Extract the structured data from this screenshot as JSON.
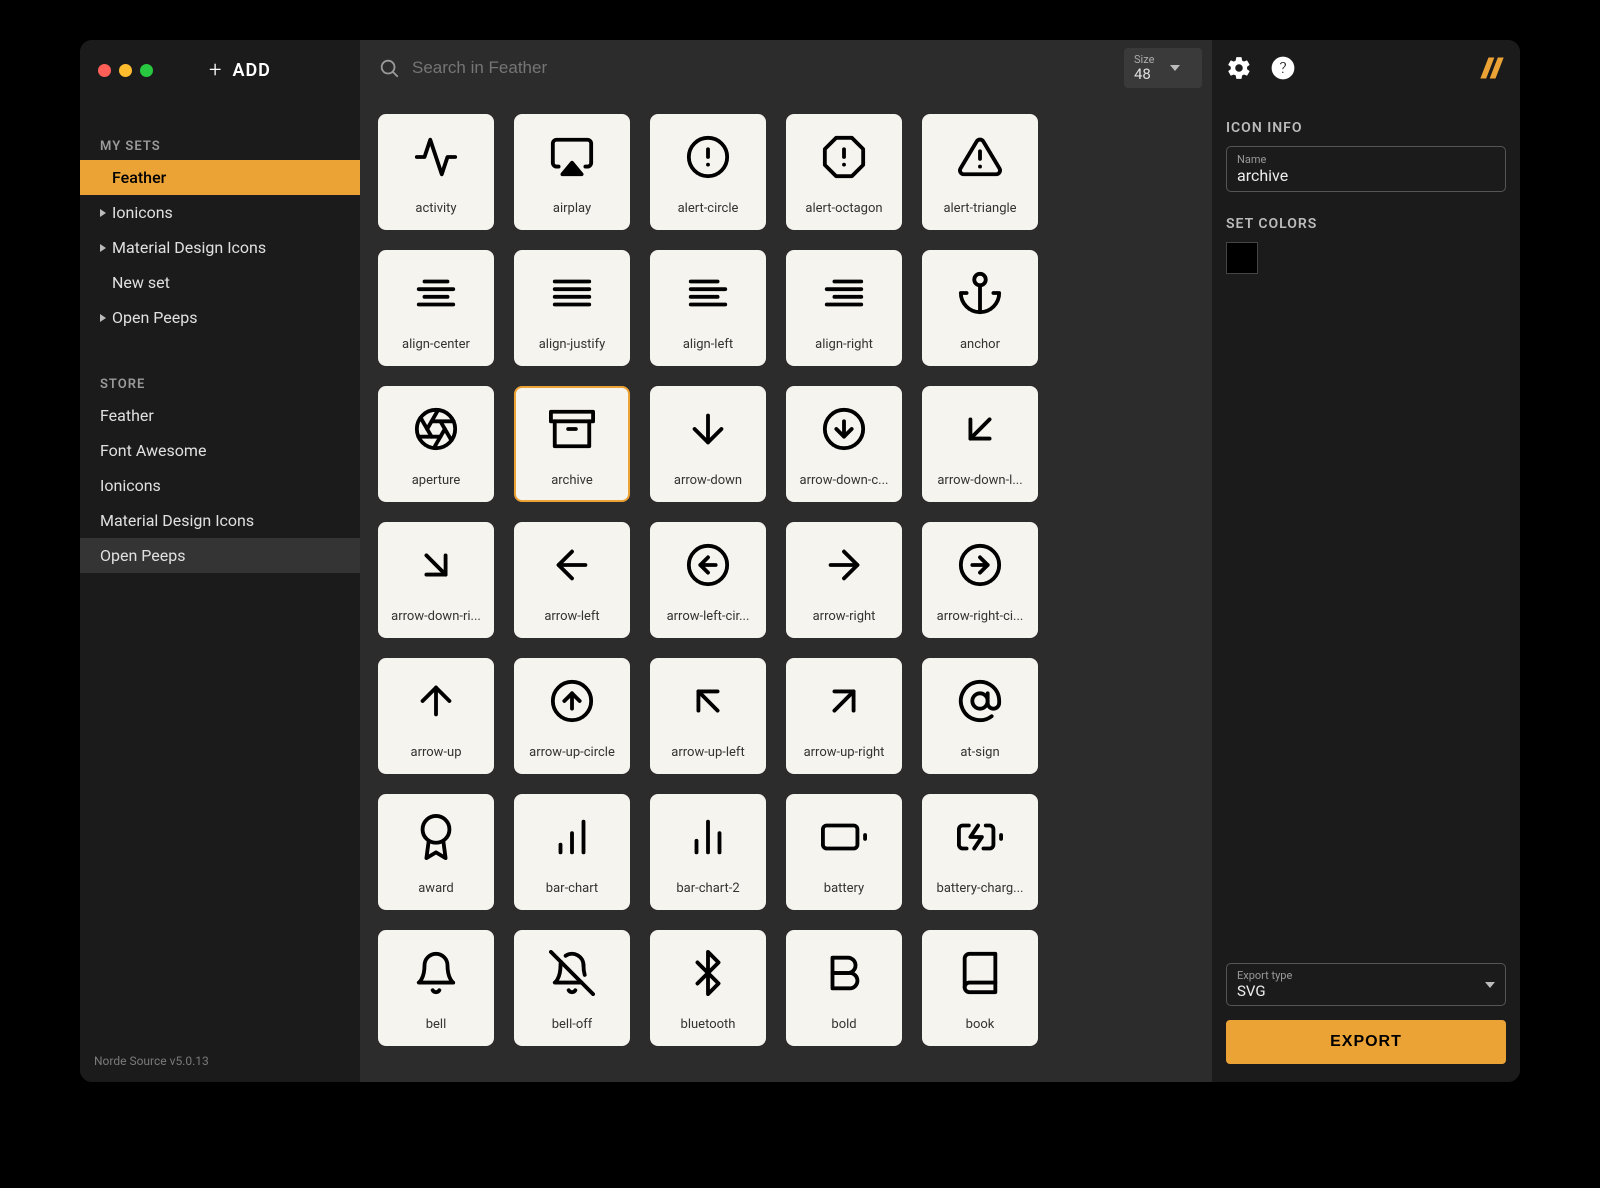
{
  "header": {
    "add_label": "ADD",
    "search_placeholder": "Search in Feather",
    "size_label": "Size",
    "size_value": "48"
  },
  "sidebar": {
    "my_sets_heading": "MY SETS",
    "store_heading": "STORE",
    "my_sets": [
      {
        "label": "Feather",
        "expandable": false,
        "active": true
      },
      {
        "label": "Ionicons",
        "expandable": true
      },
      {
        "label": "Material Design Icons",
        "expandable": true
      },
      {
        "label": "New set",
        "expandable": false
      },
      {
        "label": "Open Peeps",
        "expandable": true
      }
    ],
    "store": [
      {
        "label": "Feather"
      },
      {
        "label": "Font Awesome"
      },
      {
        "label": "Ionicons"
      },
      {
        "label": "Material Design Icons"
      },
      {
        "label": "Open Peeps",
        "hover": true
      }
    ],
    "version": "Norde Source v5.0.13"
  },
  "icons": [
    "activity",
    "airplay",
    "alert-circle",
    "alert-octagon",
    "alert-triangle",
    "align-center",
    "align-justify",
    "align-left",
    "align-right",
    "anchor",
    "aperture",
    "archive",
    "arrow-down",
    "arrow-down-circle",
    "arrow-down-left",
    "arrow-down-right",
    "arrow-left",
    "arrow-left-circle",
    "arrow-right",
    "arrow-right-circle",
    "arrow-up",
    "arrow-up-circle",
    "arrow-up-left",
    "arrow-up-right",
    "at-sign",
    "award",
    "bar-chart",
    "bar-chart-2",
    "battery",
    "battery-charging",
    "bell",
    "bell-off",
    "bluetooth",
    "bold",
    "book"
  ],
  "selected_icon": "archive",
  "icon_display_names": {
    "arrow-down-circle": "arrow-down-c...",
    "arrow-down-left": "arrow-down-l...",
    "arrow-down-right": "arrow-down-ri...",
    "arrow-left-circle": "arrow-left-cir...",
    "arrow-right-circle": "arrow-right-ci...",
    "battery-charging": "battery-charg..."
  },
  "right": {
    "info_heading": "ICON INFO",
    "name_label": "Name",
    "name_value": "archive",
    "colors_heading": "SET COLORS",
    "color": "#000000",
    "export_type_label": "Export type",
    "export_type_value": "SVG",
    "export_button": "EXPORT"
  }
}
